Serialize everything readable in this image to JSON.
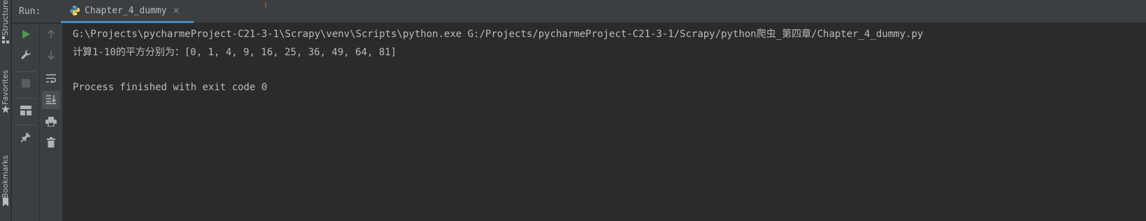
{
  "sidebar": {
    "structure_label": "Structure",
    "favorites_label": "Favorites",
    "bookmarks_label": "Bookmarks"
  },
  "run_panel": {
    "label": "Run:",
    "tab": {
      "title": "Chapter_4_dummy",
      "icon": "python-icon",
      "close_glyph": "×"
    }
  },
  "toolbar_left": {
    "buttons": [
      {
        "icon": "run-icon",
        "color": "#499c54"
      },
      {
        "icon": "wrench-icon"
      },
      {
        "icon": "stop-icon"
      },
      {
        "icon": "layout-icon"
      },
      {
        "icon": "pin-icon"
      }
    ]
  },
  "toolbar_right": {
    "buttons": [
      {
        "icon": "arrow-up-icon"
      },
      {
        "icon": "arrow-down-icon"
      },
      {
        "icon": "soft-wrap-icon"
      },
      {
        "icon": "scroll-to-end-icon"
      },
      {
        "icon": "print-icon"
      },
      {
        "icon": "trash-icon"
      }
    ]
  },
  "console": {
    "lines": [
      "G:\\Projects\\pycharmeProject-C21-3-1\\Scrapy\\venv\\Scripts\\python.exe G:/Projects/pycharmeProject-C21-3-1/Scrapy/python爬虫_第四章/Chapter_4_dummy.py",
      "计算1-10的平方分别为：[0, 1, 4, 9, 16, 25, 36, 49, 64, 81]",
      "Process finished with exit code 0"
    ]
  },
  "colors": {
    "background": "#2b2b2b",
    "panel": "#3c3f41",
    "text": "#bbbbbb",
    "accent": "#4a88c7",
    "run_green": "#499c54"
  }
}
